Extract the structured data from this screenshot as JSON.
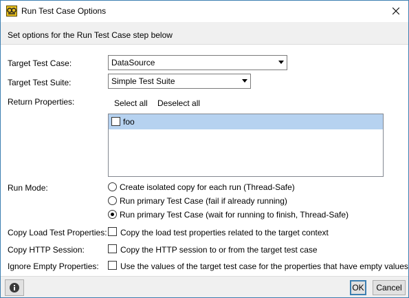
{
  "window": {
    "title": "Run Test Case Options",
    "header": "Set options for the Run Test Case step below"
  },
  "form": {
    "target_test_case": {
      "label": "Target Test Case:",
      "value": "DataSource"
    },
    "target_test_suite": {
      "label": "Target Test Suite:",
      "value": "Simple Test Suite"
    },
    "return_properties": {
      "label": "Return Properties:",
      "select_all": "Select all",
      "deselect_all": "Deselect all",
      "items": [
        {
          "label": "foo",
          "checked": false
        }
      ]
    },
    "run_mode": {
      "label": "Run Mode:",
      "options": [
        {
          "label": "Create isolated copy for each run (Thread-Safe)",
          "selected": false
        },
        {
          "label": "Run primary Test Case (fail if already running)",
          "selected": false
        },
        {
          "label": "Run primary Test Case (wait for running to finish, Thread-Safe)",
          "selected": true
        }
      ]
    },
    "copy_load_test_properties": {
      "label": "Copy Load Test Properties:",
      "option": "Copy the load test properties related to the target context",
      "checked": false
    },
    "copy_http_session": {
      "label": "Copy HTTP Session:",
      "option": "Copy the HTTP session to or from the target test case",
      "checked": false
    },
    "ignore_empty_properties": {
      "label": "Ignore Empty Properties:",
      "option": "Use the values of the target test case for the properties that have empty values",
      "checked": false
    }
  },
  "footer": {
    "ok": "OK",
    "cancel": "Cancel"
  }
}
